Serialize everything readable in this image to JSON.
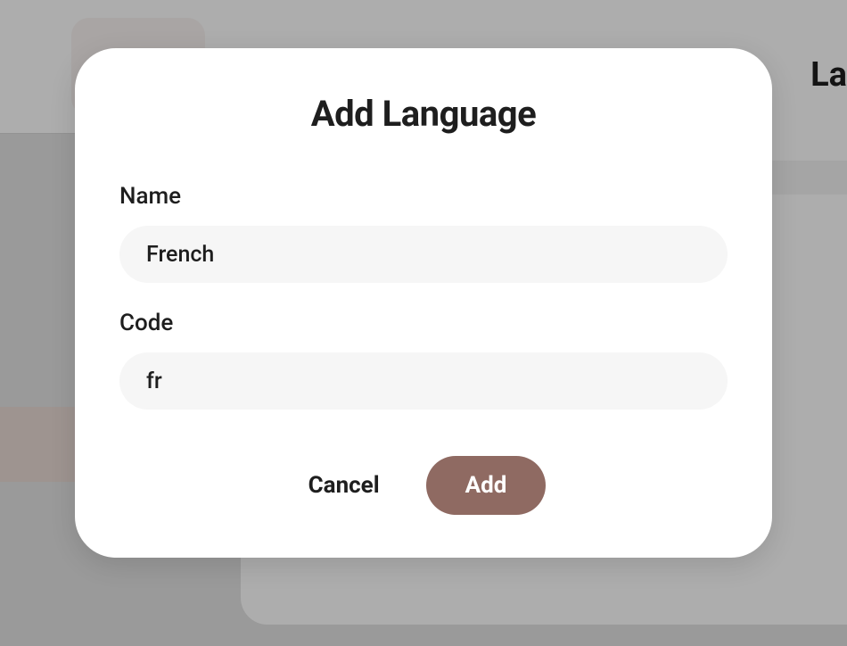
{
  "background": {
    "header_partial_text": "La"
  },
  "modal": {
    "title": "Add Language",
    "fields": {
      "name": {
        "label": "Name",
        "value": "French"
      },
      "code": {
        "label": "Code",
        "value": "fr"
      }
    },
    "actions": {
      "cancel": "Cancel",
      "add": "Add"
    }
  }
}
